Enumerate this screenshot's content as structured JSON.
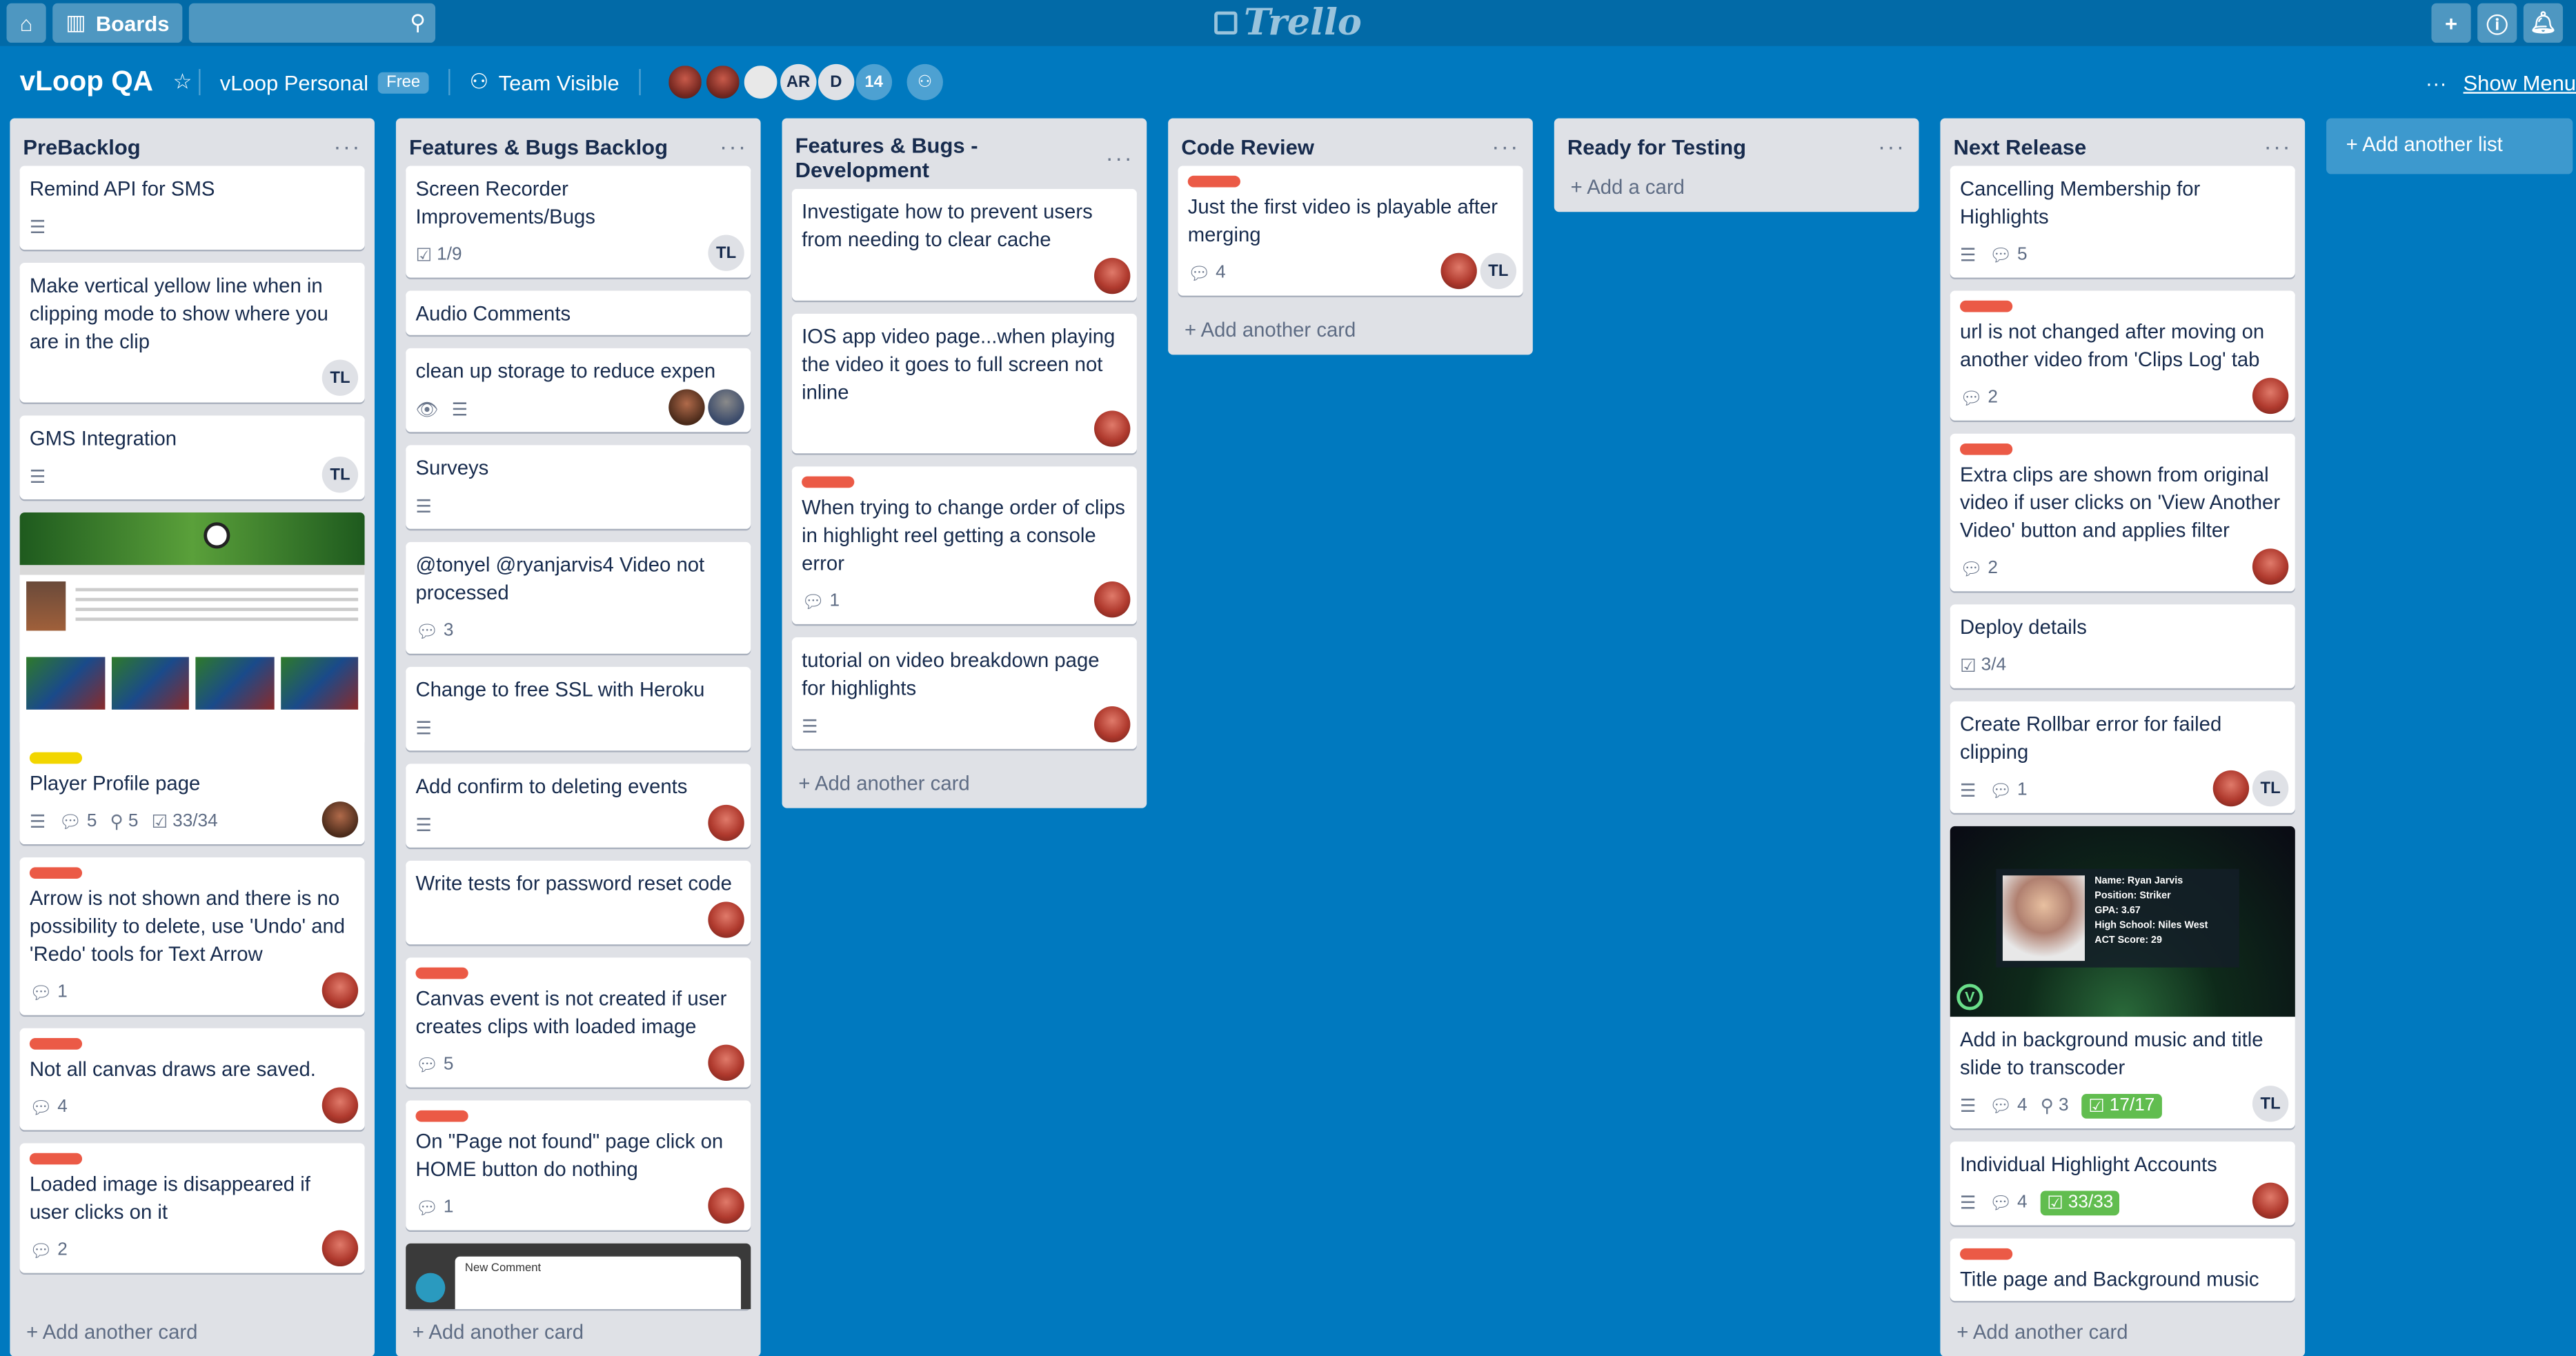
{
  "topbar": {
    "boards_label": "Boards",
    "logo": "Trello",
    "icons": [
      "home-icon",
      "boards-icon",
      "search-icon",
      "plus-icon",
      "info-icon",
      "bell-icon"
    ]
  },
  "board": {
    "title": "vLoop QA",
    "team": "vLoop Personal",
    "plan": "Free",
    "visibility": "Team Visible",
    "member_initials": [
      "AR",
      "D"
    ],
    "member_count": "14",
    "show_menu": "Show Menu"
  },
  "lists": [
    {
      "title": "PreBacklog",
      "add_label": "Add another card",
      "cards": [
        {
          "text": "Remind API for SMS",
          "desc": true
        },
        {
          "text": "Make vertical yellow line when in clipping mode to show where you are in the clip",
          "member": "TL"
        },
        {
          "text": "GMS Integration",
          "desc": true,
          "member": "TL"
        },
        {
          "text": "Player Profile page",
          "comments": "5",
          "attachments": "5",
          "checklist": "33/34"
        },
        {
          "text": "Arrow is not shown and there is no possibility to delete, use 'Undo' and 'Redo' tools for Text Arrow",
          "comments": "1"
        },
        {
          "text": "Not all canvas draws are saved.",
          "comments": "4"
        },
        {
          "text": "Loaded image is disappeared if user clicks on it",
          "comments": "2"
        }
      ]
    },
    {
      "title": "Features & Bugs Backlog",
      "add_label": "Add another card",
      "cards": [
        {
          "text": "Screen Recorder Improvements/Bugs",
          "checklist": "1/9",
          "member": "TL"
        },
        {
          "text": "Audio Comments"
        },
        {
          "text": "clean up storage to reduce expen"
        },
        {
          "text": "Surveys"
        },
        {
          "text": "@tonyel @ryanjarvis4 Video not processed",
          "comments": "3"
        },
        {
          "text": "Change to free SSL with Heroku"
        },
        {
          "text": "Add confirm to deleting events"
        },
        {
          "text": "Write tests for password reset code"
        },
        {
          "text": "Canvas event is not created if user creates clips with loaded image",
          "comments": "5"
        },
        {
          "text": "On \"Page not found\" page click on HOME button do nothing",
          "comments": "1"
        },
        {
          "text": "New Comment"
        }
      ]
    },
    {
      "title": "Features & Bugs - Development",
      "add_label": "Add another card",
      "cards": [
        {
          "text": "Investigate how to prevent users from needing to clear cache"
        },
        {
          "text": "IOS app video page...when playing the video it goes to full screen not inline"
        },
        {
          "text": "When trying to change order of clips in highlight reel getting a console error",
          "comments": "1"
        },
        {
          "text": "tutorial on video breakdown page for highlights"
        }
      ]
    },
    {
      "title": "Code Review",
      "add_label": "Add another card",
      "cards": [
        {
          "text": "Just the first video is playable after merging",
          "comments": "4",
          "member": "TL"
        }
      ]
    },
    {
      "title": "Ready for Testing",
      "add_label": "Add a card",
      "cards": []
    },
    {
      "title": "Next Release",
      "add_label": "Add another card",
      "cards": [
        {
          "text": "Cancelling Membership for Highlights",
          "comments": "5"
        },
        {
          "text": "url is not changed after moving on another video from 'Clips Log' tab",
          "comments": "2"
        },
        {
          "text": "Extra clips are shown from original video if user clicks on 'View Another Video' button and applies filter",
          "comments": "2"
        },
        {
          "text": "Deploy details",
          "checklist": "3/4"
        },
        {
          "text": "Create Rollbar error for failed clipping",
          "comments": "1",
          "member": "TL"
        },
        {
          "text": "Add in background music and title slide to transcoder",
          "comments": "4",
          "attachments": "3",
          "checklist": "17/17",
          "member": "TL"
        },
        {
          "text": "Individual Highlight Accounts",
          "comments": "4",
          "checklist": "33/33"
        },
        {
          "text": "Title page and Background music"
        }
      ]
    }
  ],
  "add_list_label": "Add another list",
  "cover_stadium": {
    "name": "Name: Ryan Jarvis",
    "position": "Position: Striker",
    "gpa": "GPA: 3.67",
    "school": "High School: Niles West",
    "act": "ACT Score: 29"
  },
  "colors": {
    "board_bg": "#0079bf",
    "label_red": "#eb5a46",
    "label_yellow": "#f2d600",
    "badge_green": "#61bd4f"
  }
}
